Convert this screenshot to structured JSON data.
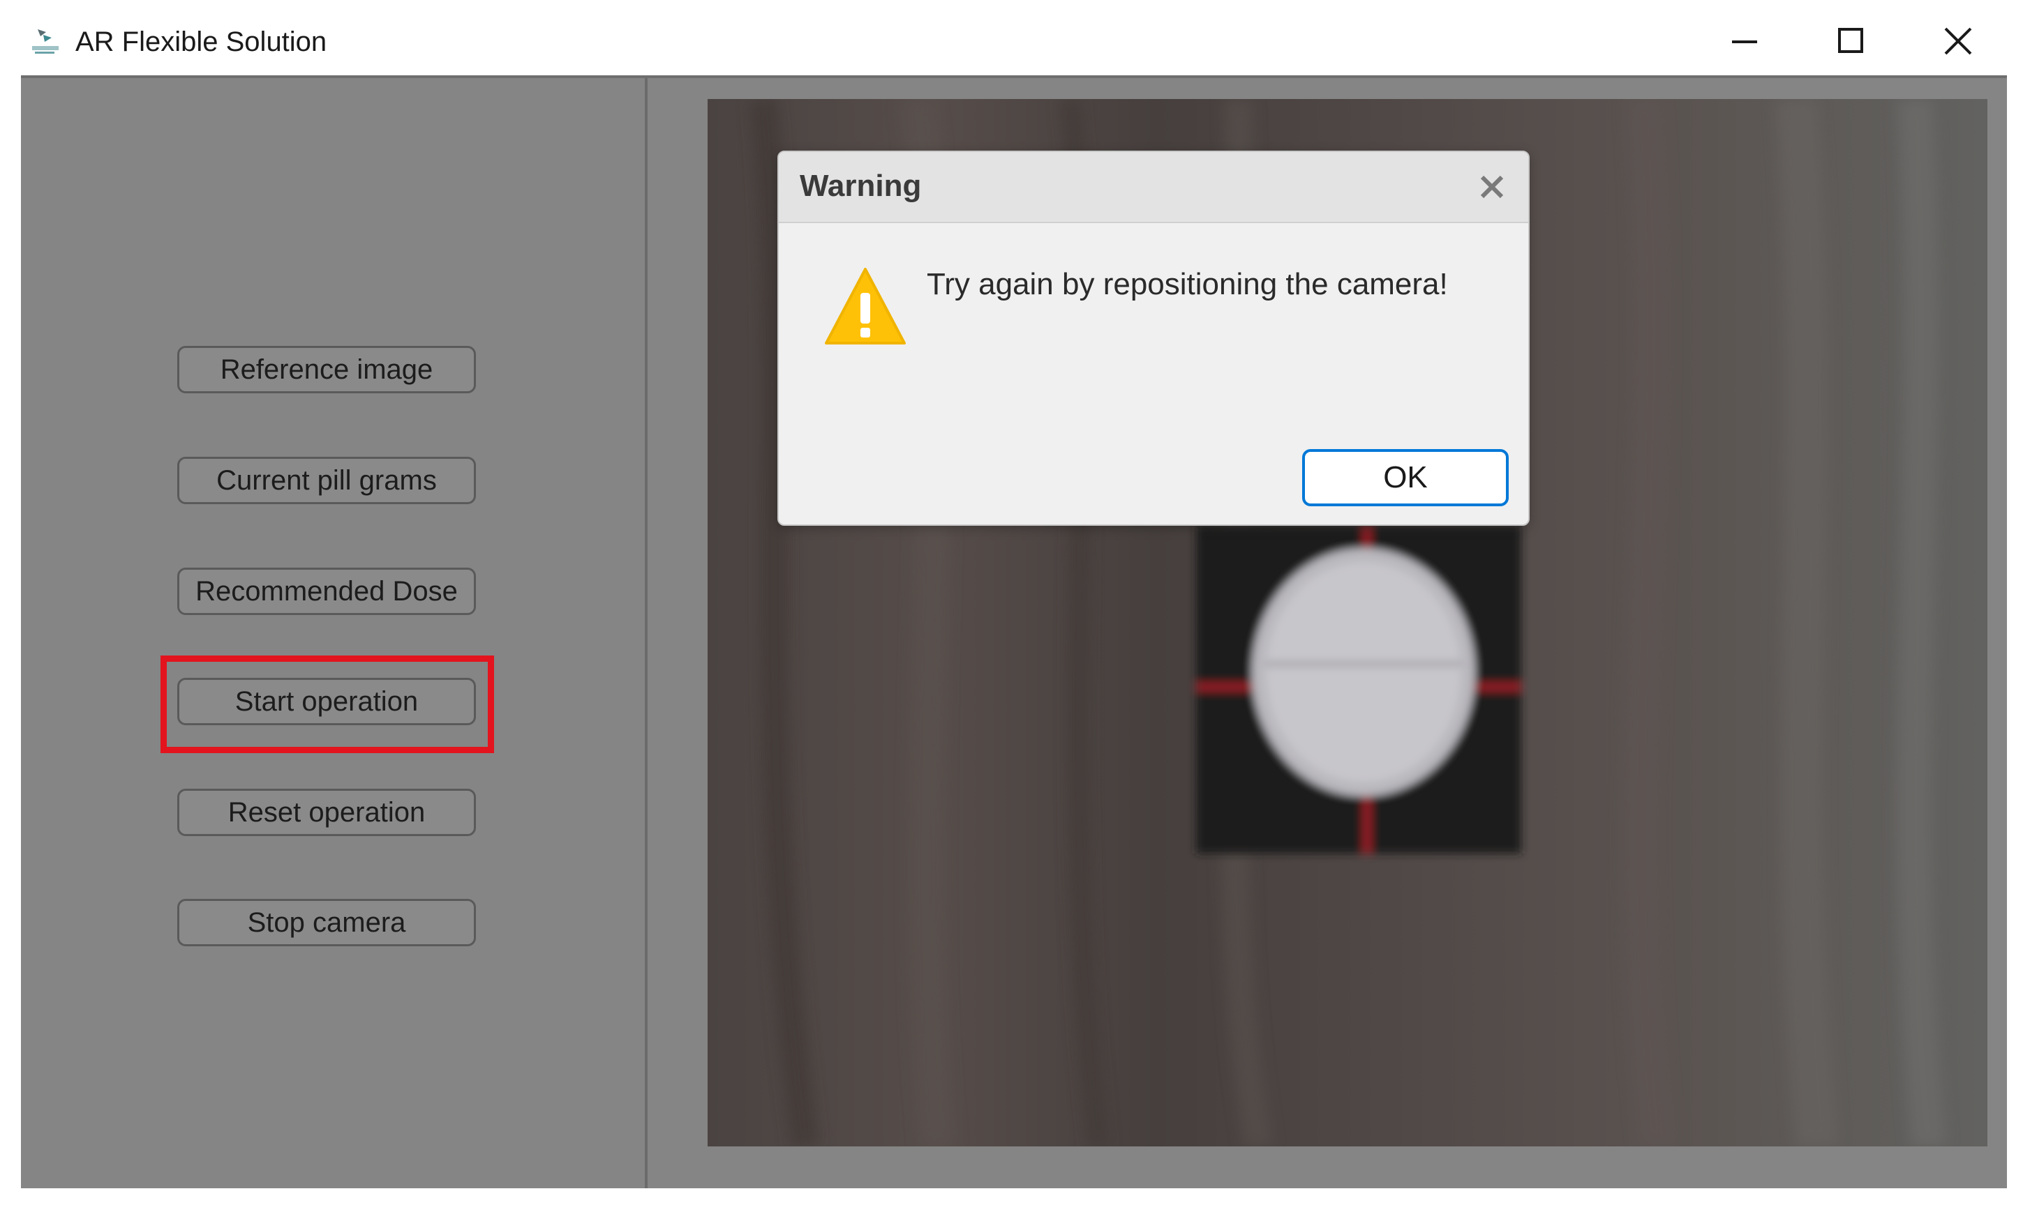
{
  "window": {
    "title": "AR Flexible Solution",
    "icon": "app-logo-icon",
    "controls": [
      "minimize-icon",
      "maximize-icon",
      "close-icon"
    ]
  },
  "sidebar": {
    "buttons": [
      {
        "label": "Reference image"
      },
      {
        "label": "Current pill grams"
      },
      {
        "label": "Recommended Dose"
      },
      {
        "label": "Start operation",
        "highlighted": true
      },
      {
        "label": "Reset operation"
      },
      {
        "label": "Stop camera"
      }
    ]
  },
  "camera_view": {
    "content": "camera-feed-image"
  },
  "dialog": {
    "title": "Warning",
    "icon": "warning-icon",
    "message": "Try again by repositioning the camera!",
    "ok_label": "OK"
  },
  "colors": {
    "highlight": "#e3141d",
    "ok_border": "#0078d7",
    "warning": "#ffc107",
    "overlay_background": "#858585"
  }
}
